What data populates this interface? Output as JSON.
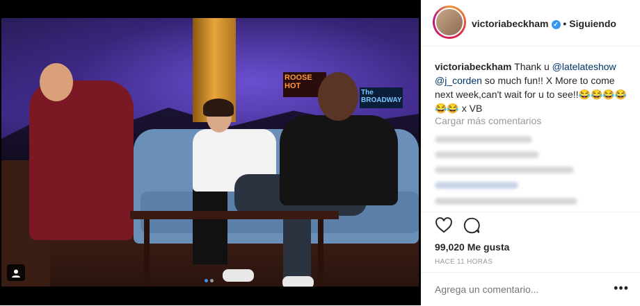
{
  "post": {
    "username": "victoriabeckham",
    "follow_status": "Siguiendo",
    "separator": "•",
    "caption": {
      "username": "victoriabeckham",
      "text_1": "Thank u ",
      "mention_1": "@latelateshow",
      "mention_2": "@j_corden",
      "text_2": " so much fun!! X More to come next week,can't wait for u to see!!😂😂😂😂😂😂 x VB"
    },
    "load_more": "Cargar más comentarios",
    "likes": "99,020 Me gusta",
    "timestamp": "HACE 11 HORAS",
    "comment_placeholder": "Agrega un comentario...",
    "more_options": "•••"
  },
  "media": {
    "sign_1": "ROOSE HOT",
    "sign_2": "The BROADWAY",
    "user_tag_icon": "user-icon",
    "carousel_dots": 2,
    "active_dot": 0
  },
  "colors": {
    "accent": "#3897f0",
    "mention": "#003569",
    "muted": "#999999"
  }
}
